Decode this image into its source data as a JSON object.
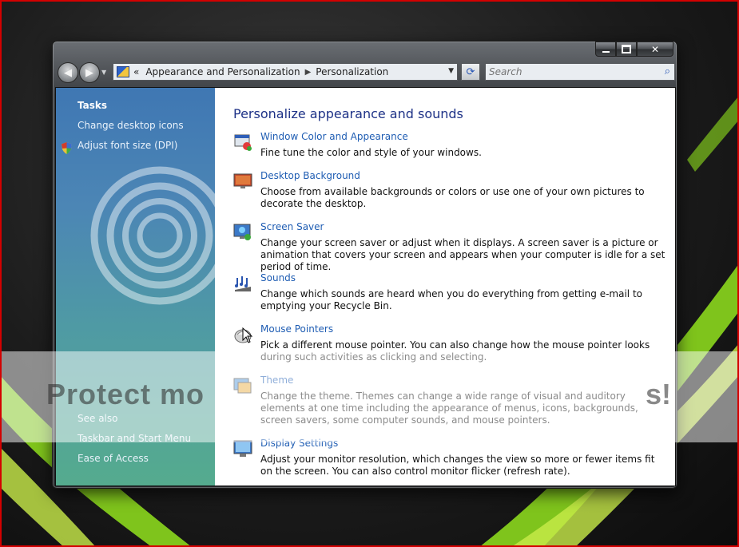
{
  "window": {
    "caption": {
      "minimize": "",
      "maximize": "",
      "close": ""
    }
  },
  "address": {
    "overflow": "«",
    "segments": [
      "Appearance and Personalization",
      "Personalization"
    ],
    "separator": "▶"
  },
  "search": {
    "placeholder": "Search"
  },
  "sidebar": {
    "tasks_title": "Tasks",
    "tasks": [
      "Change desktop icons",
      "Adjust font size (DPI)"
    ],
    "see_also_title": "See also",
    "see_also": [
      "Taskbar and Start Menu",
      "Ease of Access"
    ]
  },
  "main": {
    "heading": "Personalize appearance and sounds",
    "items": [
      {
        "title": "Window Color and Appearance",
        "desc": "Fine tune the color and style of your windows.",
        "icon": "window-color-icon"
      },
      {
        "title": "Desktop Background",
        "desc": "Choose from available backgrounds or colors or use one of your own pictures to decorate the desktop.",
        "icon": "desktop-background-icon"
      },
      {
        "title": "Screen Saver",
        "desc": "Change your screen saver or adjust when it displays. A screen saver is a picture or animation that covers your screen and appears when your computer is idle for a set period of time.",
        "icon": "screen-saver-icon"
      },
      {
        "title": "Sounds",
        "desc": "Change which sounds are heard when you do everything from getting e-mail to emptying your Recycle Bin.",
        "icon": "sounds-icon"
      },
      {
        "title": "Mouse Pointers",
        "desc": "Pick a different mouse pointer. You can also change how the mouse pointer looks during such activities as clicking and selecting.",
        "icon": "mouse-pointers-icon"
      },
      {
        "title": "Theme",
        "desc": "Change the theme. Themes can change a wide range of visual and auditory elements at one time including the appearance of menus, icons, backgrounds, screen savers, some computer sounds, and mouse pointers.",
        "icon": "theme-icon"
      },
      {
        "title": "Display Settings",
        "desc": "Adjust your monitor resolution, which changes the view so more or fewer items fit on the screen. You can also control monitor flicker (refresh rate).",
        "icon": "display-settings-icon"
      }
    ]
  },
  "watermark": {
    "text": "Protect mo",
    "tail": "s!"
  },
  "colors": {
    "link": "#1f5db3",
    "heading": "#1e3287",
    "sidebar_top": "#3f77b3",
    "sidebar_bottom": "#55ab8e",
    "frame_border": "#d40000"
  }
}
